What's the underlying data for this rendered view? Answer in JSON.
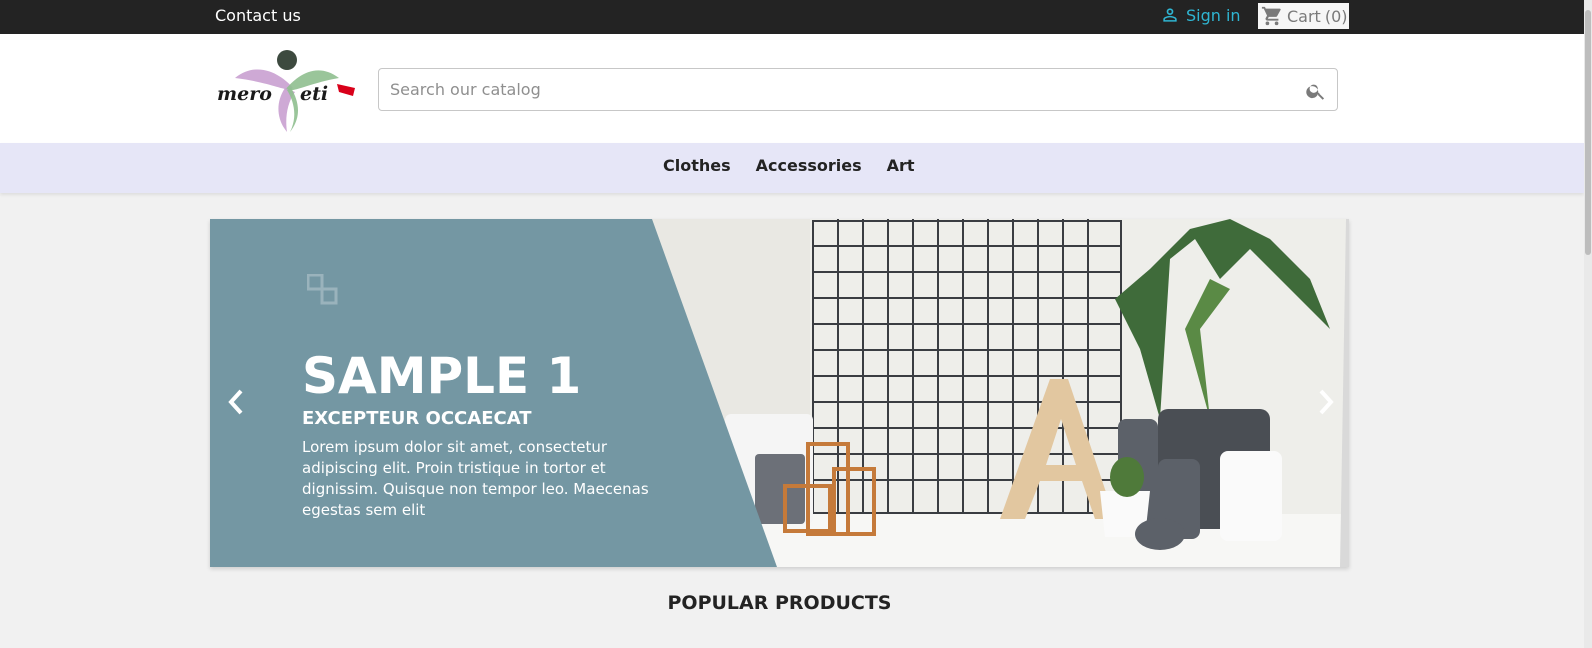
{
  "topbar": {
    "contact_label": "Contact us",
    "signin_label": "Sign in",
    "cart_label": "Cart",
    "cart_count": "(0)"
  },
  "header": {
    "logo_text_left": "mero",
    "logo_text_right": "eti",
    "search_placeholder": "Search our catalog"
  },
  "nav": {
    "items": [
      {
        "label": "Clothes"
      },
      {
        "label": "Accessories"
      },
      {
        "label": "Art"
      }
    ]
  },
  "slider": {
    "title": "SAMPLE 1",
    "subtitle": "EXCEPTEUR OCCAECAT",
    "text": "Lorem ipsum dolor sit amet, consectetur adipiscing elit. Proin tristique in tortor et dignissim. Quisque non tempor leo. Maecenas egestas sem elit"
  },
  "sections": {
    "popular_title": "POPULAR PRODUCTS"
  },
  "colors": {
    "topbar": "#232323",
    "accent": "#2fb5d2",
    "nav_bg": "#e6e6f7",
    "slide_panel": "#7497a3"
  }
}
